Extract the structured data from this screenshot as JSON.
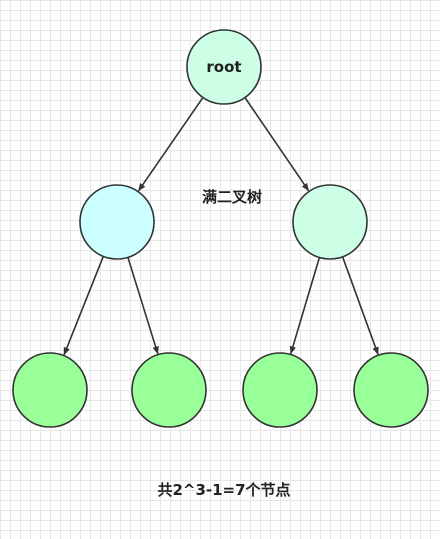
{
  "diagram": {
    "title": "满二叉树",
    "caption": "共2^3-1=7个节点",
    "nodes": [
      {
        "id": "root",
        "label": "root",
        "level": 0,
        "fill": "#ccffe6"
      },
      {
        "id": "left-child",
        "label": "",
        "level": 1,
        "fill": "#ccffff"
      },
      {
        "id": "right-child",
        "label": "",
        "level": 1,
        "fill": "#ccffe6"
      },
      {
        "id": "leaf-1",
        "label": "",
        "level": 2,
        "fill": "#99ff99"
      },
      {
        "id": "leaf-2",
        "label": "",
        "level": 2,
        "fill": "#99ff99"
      },
      {
        "id": "leaf-3",
        "label": "",
        "level": 2,
        "fill": "#99ff99"
      },
      {
        "id": "leaf-4",
        "label": "",
        "level": 2,
        "fill": "#99ff99"
      }
    ],
    "edges": [
      {
        "from": "root",
        "to": "left-child"
      },
      {
        "from": "root",
        "to": "right-child"
      },
      {
        "from": "left-child",
        "to": "leaf-1"
      },
      {
        "from": "left-child",
        "to": "leaf-2"
      },
      {
        "from": "right-child",
        "to": "leaf-3"
      },
      {
        "from": "right-child",
        "to": "leaf-4"
      }
    ],
    "stroke_color": "#333333"
  }
}
